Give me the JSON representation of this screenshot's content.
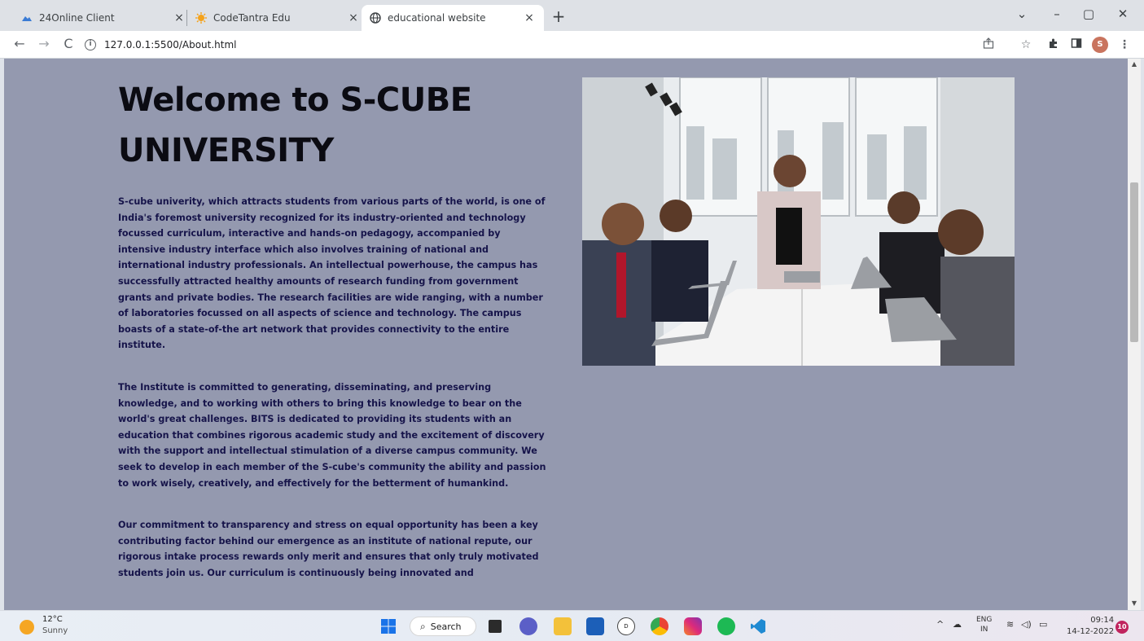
{
  "browser": {
    "tabs": [
      {
        "title": "24Online Client",
        "icon": "24online-icon",
        "close": "×"
      },
      {
        "title": "CodeTantra Edu",
        "icon": "codetantra-icon",
        "close": "×"
      },
      {
        "title": "educational website",
        "icon": "globe-icon",
        "close": "×"
      }
    ],
    "new_tab": "+",
    "window_controls": {
      "dropdown": "⌄",
      "minimize": "–",
      "maximize": "▢",
      "close": "✕"
    },
    "url": "127.0.0.1:5500/About.html",
    "nav": {
      "back": "←",
      "forward": "→",
      "reload": "C"
    },
    "profile_initial": "S"
  },
  "page": {
    "title": "Welcome to S-CUBE UNIVERSITY",
    "paragraphs": [
      "S-cube univerity, which attracts students from various parts of the world, is one of India's foremost university recognized for its industry-oriented and technology focussed curriculum, interactive and hands-on pedagogy, accompanied by intensive industry interface which also involves training of national and international industry professionals. An intellectual powerhouse, the campus has successfully attracted healthy amounts of research funding from government grants and private bodies. The research facilities are wide ranging, with a number of laboratories focussed on all aspects of science and technology. The campus boasts of a state-of-the art network that provides connectivity to the entire institute.",
      "The Institute is committed to generating, disseminating, and preserving knowledge, and to working with others to bring this knowledge to bear on the world's great challenges. BITS is dedicated to providing its students with an education that combines rigorous academic study and the excitement of discovery with the support and intellectual stimulation of a diverse campus community. We seek to develop in each member of the S-cube's community the ability and passion to work wisely, creatively, and effectively for the betterment of humankind.",
      "Our commitment to transparency and stress on equal opportunity has been a key contributing factor behind our emergence as an institute of national repute, our rigorous intake process rewards only merit and ensures that only truly motivated students join us. Our curriculum is continuously being innovated and"
    ]
  },
  "taskbar": {
    "weather_temp": "12°C",
    "weather_desc": "Sunny",
    "search_label": "Search",
    "lang_1": "ENG",
    "lang_2": "IN",
    "time": "09:14",
    "date": "14-12-2022",
    "notifications": "10"
  },
  "colors": {
    "page_background": "#9499af",
    "heading": "#0b0b12",
    "body_text": "#16144a"
  }
}
